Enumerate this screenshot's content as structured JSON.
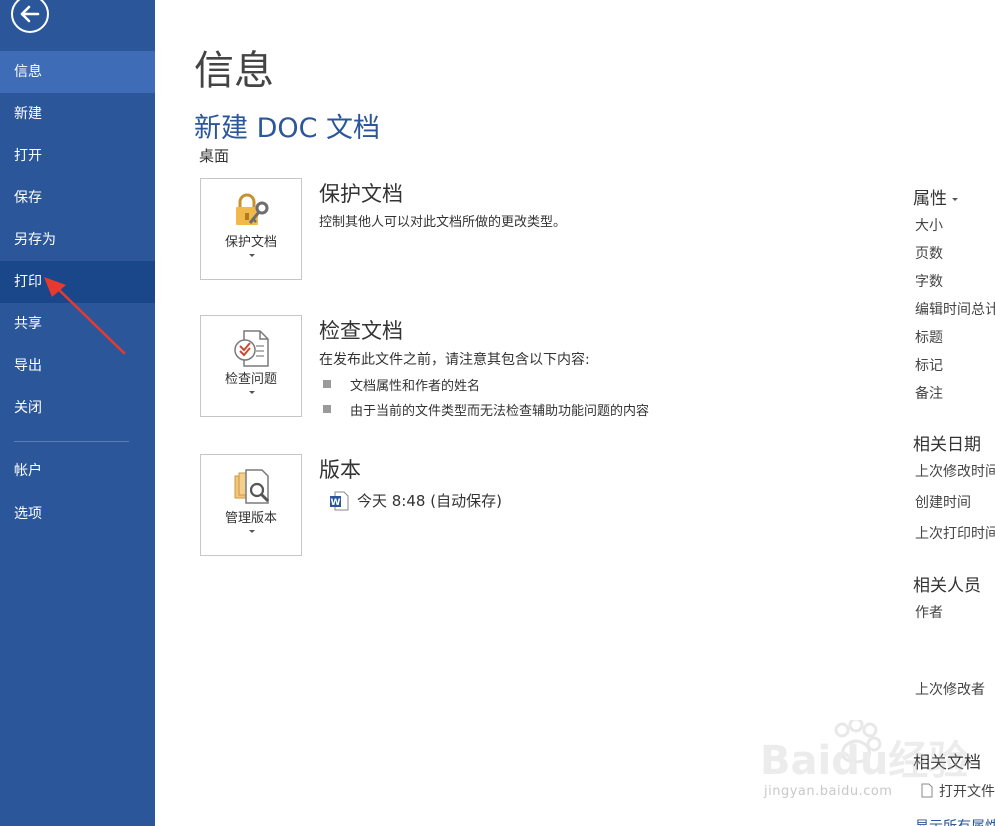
{
  "sidebar": {
    "items": [
      {
        "label": "信息"
      },
      {
        "label": "新建"
      },
      {
        "label": "打开"
      },
      {
        "label": "保存"
      },
      {
        "label": "另存为"
      },
      {
        "label": "打印"
      },
      {
        "label": "共享"
      },
      {
        "label": "导出"
      },
      {
        "label": "关闭"
      },
      {
        "label": "帐户"
      },
      {
        "label": "选项"
      }
    ],
    "selected_index": 0,
    "hover_index": 5,
    "bg_color": "#2b579a",
    "selected_color": "#3f6cb6"
  },
  "main": {
    "page_title": "信息",
    "doc_name": "新建 DOC 文档",
    "doc_location": "桌面",
    "sections": [
      {
        "button_label": "保护文档",
        "icon": "lock-key-icon",
        "title": "保护文档",
        "description": "控制其他人可以对此文档所做的更改类型。"
      },
      {
        "button_label": "检查问题",
        "icon": "inspect-document-icon",
        "title": "检查文档",
        "description": "在发布此文件之前，请注意其包含以下内容:",
        "bullets": [
          "文档属性和作者的姓名",
          "由于当前的文件类型而无法检查辅助功能问题的内容"
        ]
      },
      {
        "button_label": "管理版本",
        "icon": "manage-versions-icon",
        "title": "版本",
        "version_entry": "今天 8:48 (自动保存)"
      }
    ]
  },
  "properties": {
    "heading": "属性",
    "items": [
      "大小",
      "页数",
      "字数",
      "编辑时间总计",
      "标题",
      "标记",
      "备注"
    ],
    "dates_heading": "相关日期",
    "dates": [
      "上次修改时间",
      "创建时间",
      "上次打印时间"
    ],
    "people_heading": "相关人员",
    "people": [
      "作者",
      "上次修改者"
    ],
    "docs_heading": "相关文档",
    "docs": [
      "打开文件位置"
    ],
    "show_all": "显示所有属性"
  },
  "watermark": {
    "brand": "Baidu经验",
    "url": "jingyan.baidu.com"
  },
  "colors": {
    "accent": "#2b579a",
    "annotation_arrow": "#e8392f"
  }
}
